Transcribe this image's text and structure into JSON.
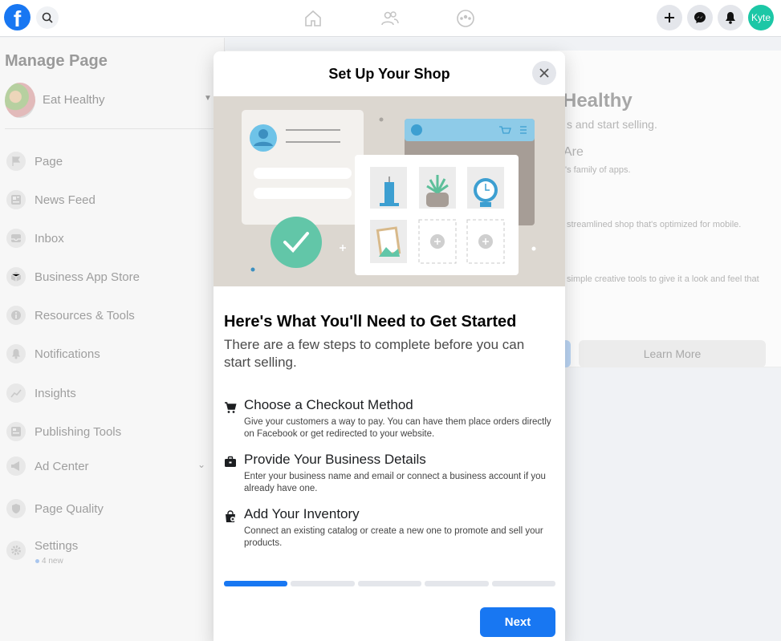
{
  "topbar": {
    "avatar_label": "Kyte"
  },
  "sidebar": {
    "title": "Manage Page",
    "page_name": "Eat Healthy",
    "items": [
      {
        "label": "Page",
        "icon": "flag-icon"
      },
      {
        "label": "News Feed",
        "icon": "news-feed-icon"
      },
      {
        "label": "Inbox",
        "icon": "inbox-icon"
      },
      {
        "label": "Business App Store",
        "icon": "cube-icon"
      },
      {
        "label": "Resources & Tools",
        "icon": "info-icon"
      },
      {
        "label": "Notifications",
        "icon": "bell-icon"
      },
      {
        "label": "Insights",
        "icon": "chart-icon"
      },
      {
        "label": "Publishing Tools",
        "icon": "publishing-icon"
      },
      {
        "label": "Ad Center",
        "icon": "megaphone-icon"
      },
      {
        "label": "Page Quality",
        "icon": "shield-icon"
      },
      {
        "label": "Settings",
        "icon": "gear-icon",
        "sub": "4 new"
      }
    ]
  },
  "background": {
    "heading": "Healthy",
    "line1": "s and start selling.",
    "subheading": "Are",
    "line2": "'s family of apps.",
    "line3": "streamlined shop that's optimized for mobile.",
    "line4": "simple creative tools to give it a look and feel that",
    "learn_more": "Learn More"
  },
  "modal": {
    "title": "Set Up Your Shop",
    "heading": "Here's What You'll Need to Get Started",
    "subheading": "There are a few steps to complete before you can start selling.",
    "steps": [
      {
        "title": "Choose a Checkout Method",
        "desc": "Give your customers a way to pay. You can have them place orders directly on Facebook or get redirected to your website.",
        "icon": "cart-icon"
      },
      {
        "title": "Provide Your Business Details",
        "desc": "Enter your business name and email or connect a business account if you already have one.",
        "icon": "briefcase-icon"
      },
      {
        "title": "Add Your Inventory",
        "desc": "Connect an existing catalog or create a new one to promote and sell your products.",
        "icon": "shopping-bag-icon"
      }
    ],
    "progress": {
      "current": 1,
      "total": 5
    },
    "next_label": "Next"
  },
  "colors": {
    "accent": "#1877f2",
    "avatar": "#1cc7a6",
    "check": "#5dc8a6"
  }
}
